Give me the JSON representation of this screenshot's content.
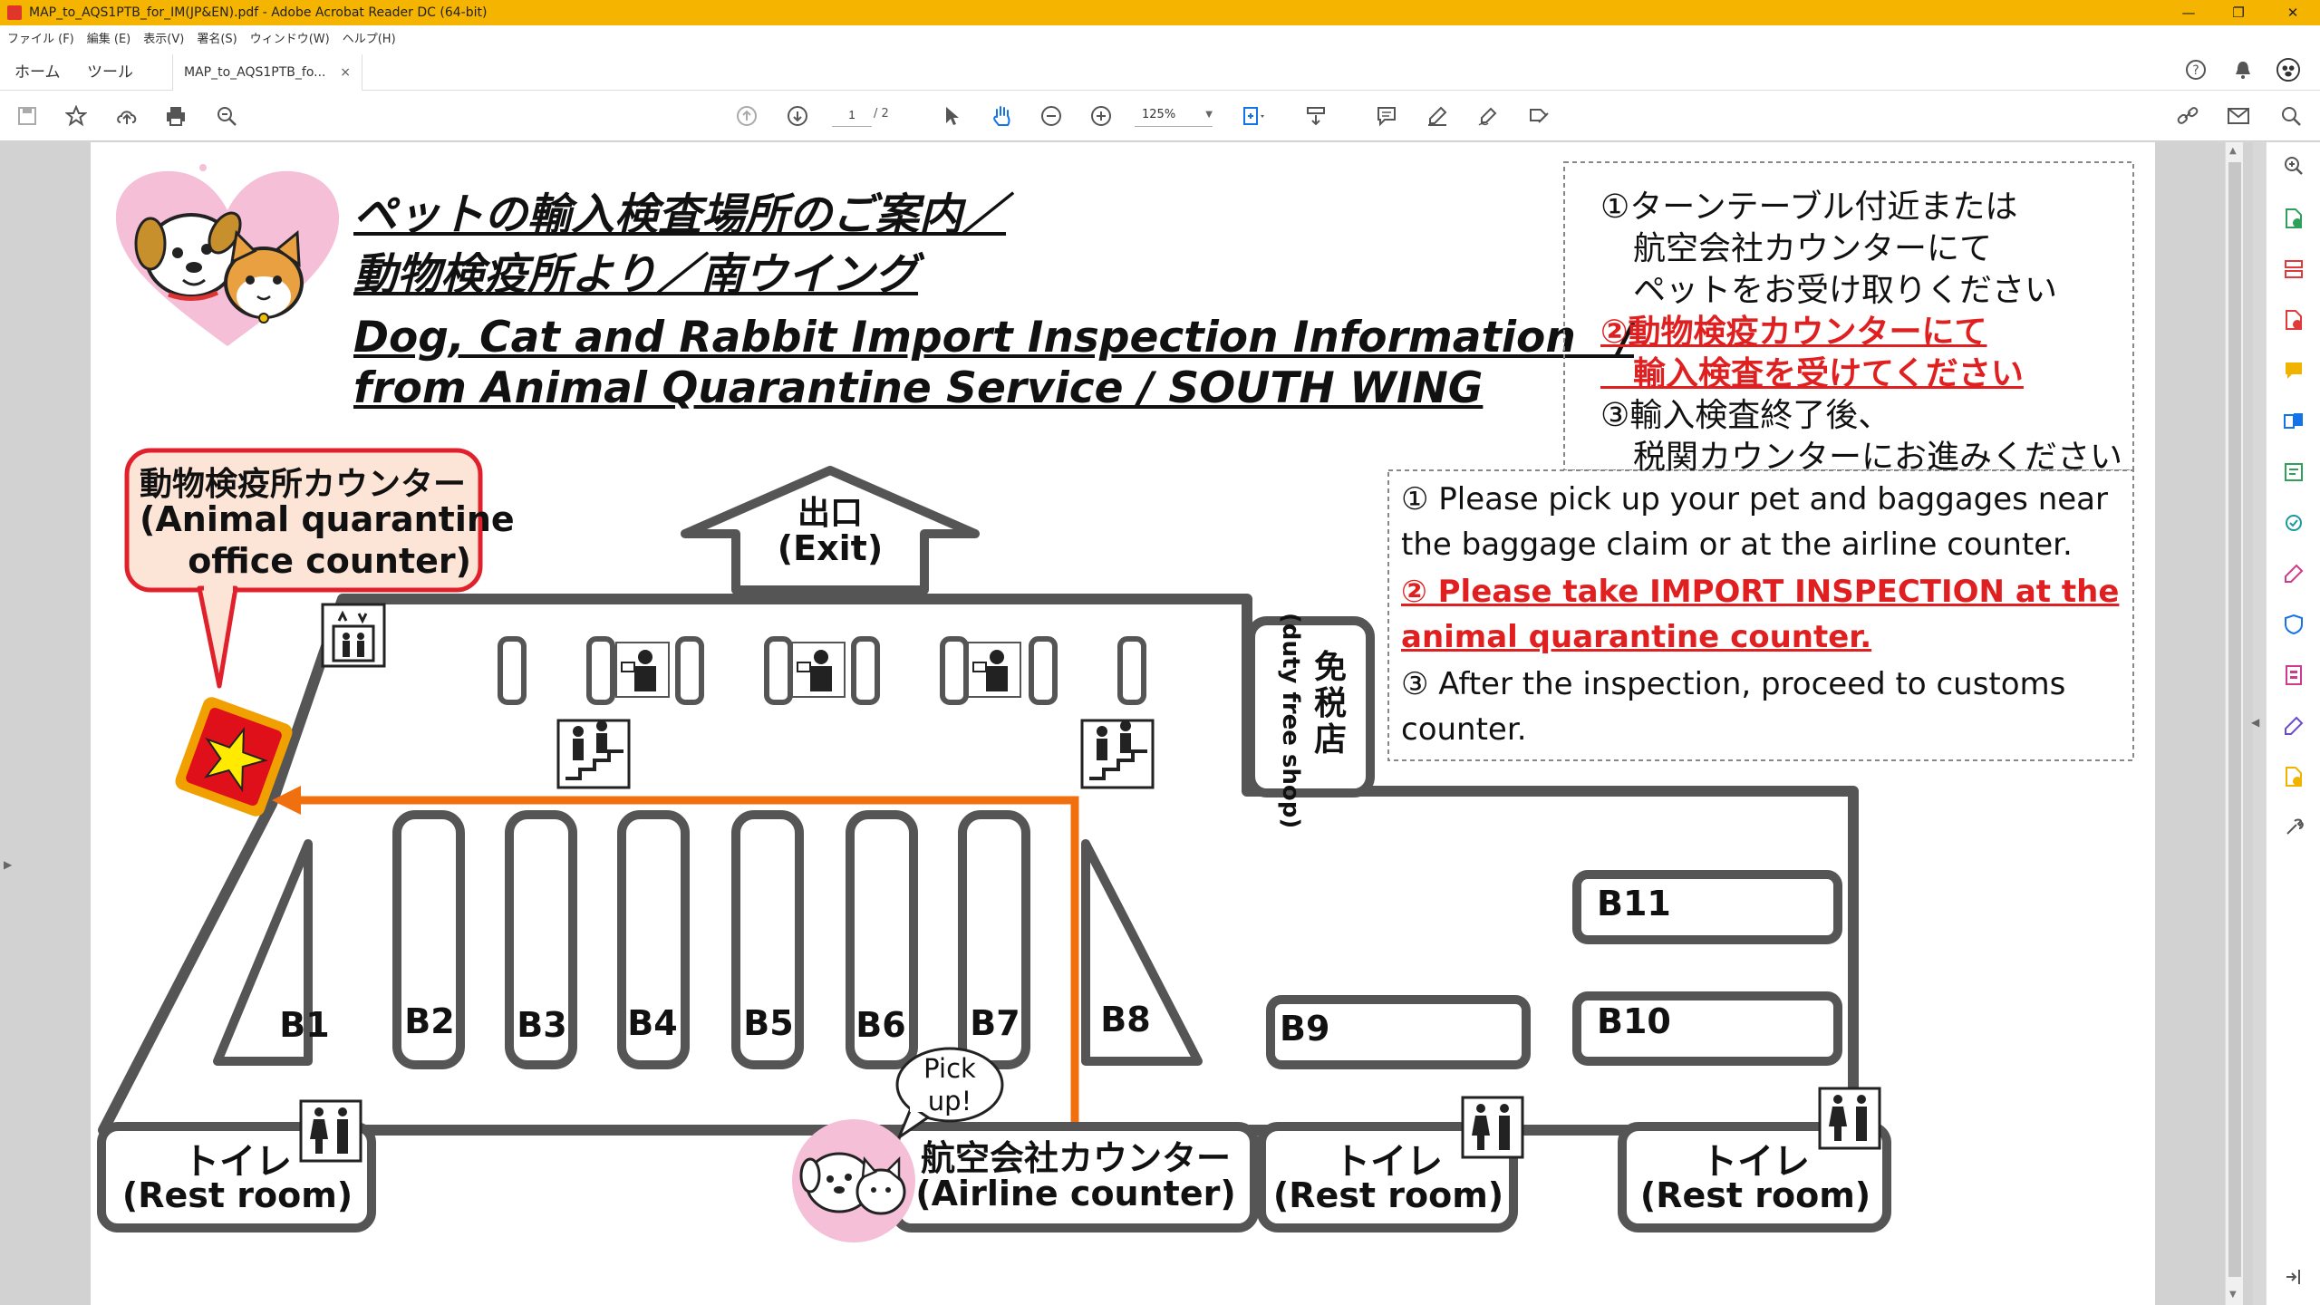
{
  "window": {
    "title": "MAP_to_AQS1PTB_for_IM(JP&EN).pdf - Adobe Acrobat Reader DC (64-bit)",
    "controls": [
      "—",
      "❐",
      "✕"
    ]
  },
  "menu": [
    "ファイル (F)",
    "編集 (E)",
    "表示(V)",
    "署名(S)",
    "ウィンドウ(W)",
    "ヘルプ(H)"
  ],
  "tabs": {
    "home": "ホーム",
    "tools": "ツール",
    "document": "MAP_to_AQS1PTB_fo...",
    "close": "×"
  },
  "toolbar": {
    "page_current": "1",
    "page_total": "/ 2",
    "zoom": "125%"
  },
  "map": {
    "title_jp_1": "ペットの輸入検査場所のご案内／",
    "title_jp_2": "動物検疫所より／南ウイング",
    "title_en_1": "Dog, Cat and Rabbit Import Inspection Information　/",
    "title_en_2": "from Animal Quarantine Service / SOUTH WING",
    "jp_steps": [
      {
        "text": "①ターンテーブル付近または",
        "style": "normal"
      },
      {
        "text": "　航空会社カウンターにて",
        "style": "normal"
      },
      {
        "text": "　ペットをお受け取りください",
        "style": "normal"
      },
      {
        "text": "②動物検疫カウンターにて",
        "style": "red"
      },
      {
        "text": "　輸入検査を受けてください",
        "style": "red"
      },
      {
        "text": "③輸入検査終了後、",
        "style": "normal"
      },
      {
        "text": "　税関カウンターにお進みください",
        "style": "normal"
      }
    ],
    "en_steps": [
      {
        "text": "① Please pick up your pet  and baggages near",
        "style": "normal"
      },
      {
        "text": "    the baggage claim or at the airline counter.",
        "style": "normal"
      },
      {
        "text": "② Please take IMPORT INSPECTION at the",
        "style": "red"
      },
      {
        "text": "    animal quarantine counter.",
        "style": "red"
      },
      {
        "text": "③ After the inspection, proceed to customs",
        "style": "normal"
      },
      {
        "text": "    counter.",
        "style": "normal"
      }
    ],
    "aq_counter_jp": "動物検疫所カウンター",
    "aq_counter_en_1": "(Animal quarantine",
    "aq_counter_en_2": "office counter)",
    "exit_jp": "出口",
    "exit_en": "(Exit)",
    "dutyfree_jp": "免税店",
    "dutyfree_en": "(duty free shop)",
    "belts": [
      "B1",
      "B2",
      "B3",
      "B4",
      "B5",
      "B6",
      "B7",
      "B8",
      "B9",
      "B10",
      "B11"
    ],
    "pickup": "Pick up!",
    "airline_jp": "航空会社カウンター",
    "airline_en": "(Airline counter)",
    "restroom_jp": "トイレ",
    "restroom_en": "(Rest room)"
  }
}
